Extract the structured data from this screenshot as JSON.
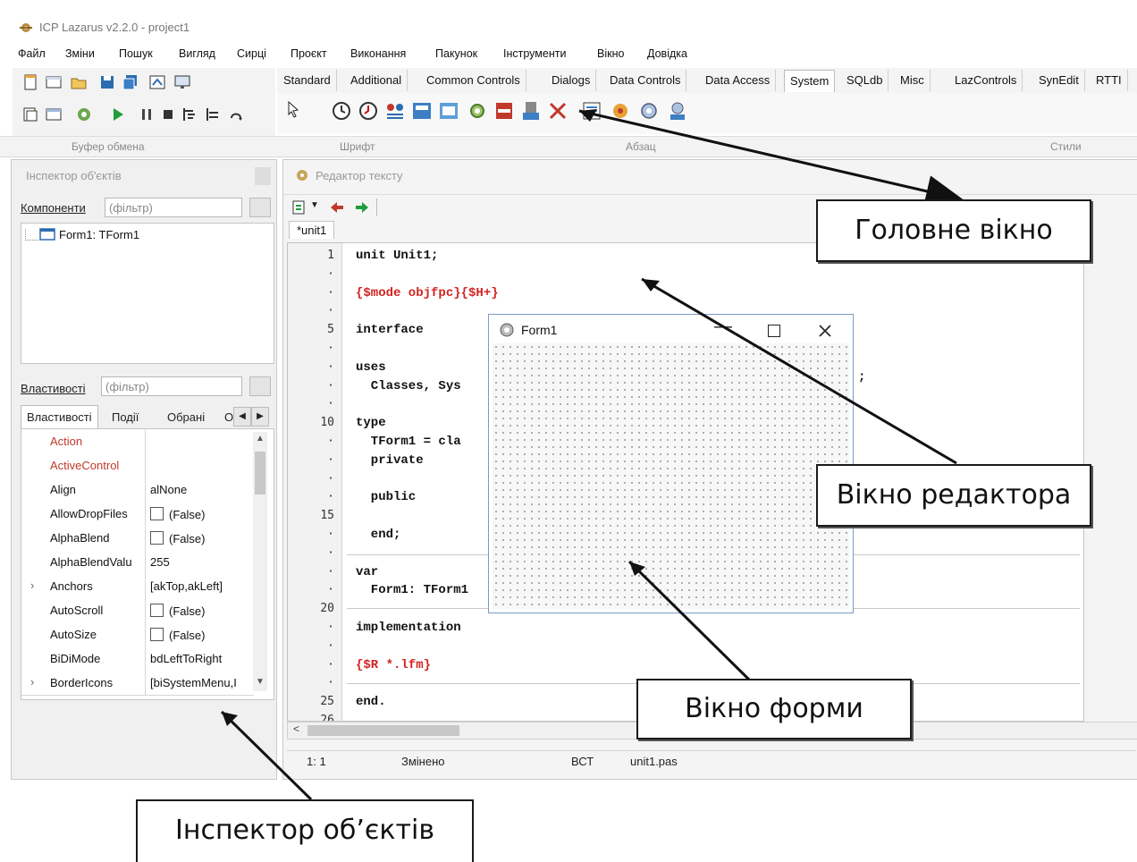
{
  "window": {
    "title": "ICP Lazarus v2.2.0 - project1"
  },
  "menu": [
    "Файл",
    "Зміни",
    "Пошук",
    "Вигляд",
    "Сирці",
    "Проєкт",
    "Виконання",
    "Пакунок",
    "Інструменти",
    "Вікно",
    "Довідка"
  ],
  "palette_tabs": [
    "Standard",
    "Additional",
    "Common Controls",
    "Dialogs",
    "Data Controls",
    "Data Access",
    "System",
    "SQLdb",
    "Misc",
    "LazControls",
    "SynEdit",
    "RTTI"
  ],
  "palette_active": "System",
  "ribbon_labels": [
    "Буфер обмена",
    "Шрифт",
    "Абзац",
    "Стили"
  ],
  "inspector": {
    "title": "Інспектор об'єктів",
    "components_label": "Компоненти",
    "filter_placeholder": "(фільтр)",
    "tree_item": "Form1: TForm1",
    "properties_label": "Властивості",
    "tabs": [
      "Властивості",
      "Події",
      "Обрані",
      "О"
    ],
    "rows": [
      {
        "name": "Action",
        "value": "",
        "red": true,
        "expand": false,
        "checkbox": false
      },
      {
        "name": "ActiveControl",
        "value": "",
        "red": true,
        "expand": false,
        "checkbox": false
      },
      {
        "name": "Align",
        "value": "alNone",
        "red": false,
        "expand": false,
        "checkbox": false
      },
      {
        "name": "AllowDropFiles",
        "value": "(False)",
        "red": false,
        "expand": false,
        "checkbox": true
      },
      {
        "name": "AlphaBlend",
        "value": "(False)",
        "red": false,
        "expand": false,
        "checkbox": true
      },
      {
        "name": "AlphaBlendValu",
        "value": "255",
        "red": false,
        "expand": false,
        "checkbox": false
      },
      {
        "name": "Anchors",
        "value": "[akTop,akLeft]",
        "red": false,
        "expand": true,
        "checkbox": false
      },
      {
        "name": "AutoScroll",
        "value": "(False)",
        "red": false,
        "expand": false,
        "checkbox": true
      },
      {
        "name": "AutoSize",
        "value": "(False)",
        "red": false,
        "expand": false,
        "checkbox": true
      },
      {
        "name": "BiDiMode",
        "value": "bdLeftToRight",
        "red": false,
        "expand": false,
        "checkbox": false
      },
      {
        "name": "BorderIcons",
        "value": "[biSystemMenu,I",
        "red": false,
        "expand": true,
        "checkbox": false
      }
    ]
  },
  "editor": {
    "title": "Редактор тексту",
    "tab": "*unit1",
    "gutter": [
      "1",
      "·",
      "·",
      "·",
      "5",
      "·",
      "·",
      "·",
      "·",
      "10",
      "·",
      "·",
      "·",
      "·",
      "15",
      "·",
      "·",
      "·",
      "·",
      "20",
      "·",
      "·",
      "·",
      "·",
      "25",
      "26"
    ],
    "lines": [
      {
        "text": "unit Unit1;",
        "dir": false
      },
      {
        "text": "",
        "dir": false
      },
      {
        "text": "{$mode objfpc}{$H+}",
        "dir": true
      },
      {
        "text": "",
        "dir": false
      },
      {
        "text": "interface",
        "dir": false
      },
      {
        "text": "",
        "dir": false
      },
      {
        "text": "uses",
        "dir": false
      },
      {
        "text": "  Classes, Sys",
        "dir": false
      },
      {
        "text": "",
        "dir": false
      },
      {
        "text": "type",
        "dir": false
      },
      {
        "text": "  TForm1 = cla",
        "dir": false
      },
      {
        "text": "  private",
        "dir": false
      },
      {
        "text": "",
        "dir": false
      },
      {
        "text": "  public",
        "dir": false
      },
      {
        "text": "",
        "dir": false
      },
      {
        "text": "  end;",
        "dir": false
      },
      {
        "text": "",
        "dir": false
      },
      {
        "text": "var",
        "dir": false
      },
      {
        "text": "  Form1: TForm1",
        "dir": false
      },
      {
        "text": "",
        "dir": false
      },
      {
        "text": "implementation",
        "dir": false
      },
      {
        "text": "",
        "dir": false
      },
      {
        "text": "{$R *.lfm}",
        "dir": true
      },
      {
        "text": "",
        "dir": false
      },
      {
        "text": "end.",
        "dir": false
      }
    ],
    "cut_suffix": ";",
    "status": {
      "pos": "1: 1",
      "modified": "Змінено",
      "mode": "ВСТ",
      "file": "unit1.pas"
    }
  },
  "form_window": {
    "title": "Form1"
  },
  "callouts": {
    "main": "Головне вікно",
    "editor": "Вікно редактора",
    "form": "Вікно форми",
    "inspector": "Інспектор об’єктів"
  }
}
